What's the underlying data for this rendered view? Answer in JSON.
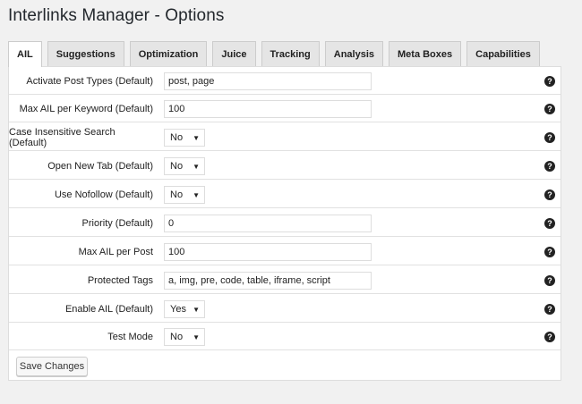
{
  "page": {
    "title": "Interlinks Manager - Options"
  },
  "tabs": [
    {
      "label": "AIL",
      "active": true
    },
    {
      "label": "Suggestions"
    },
    {
      "label": "Optimization"
    },
    {
      "label": "Juice"
    },
    {
      "label": "Tracking"
    },
    {
      "label": "Analysis"
    },
    {
      "label": "Meta Boxes"
    },
    {
      "label": "Capabilities"
    }
  ],
  "options": {
    "activate_post_types": {
      "label": "Activate Post Types (Default)",
      "value": "post, page"
    },
    "max_ail_per_keyword": {
      "label": "Max AIL per Keyword (Default)",
      "value": "100"
    },
    "case_insensitive_search": {
      "label": "Case Insensitive Search (Default)",
      "value": "No"
    },
    "open_new_tab": {
      "label": "Open New Tab (Default)",
      "value": "No"
    },
    "use_nofollow": {
      "label": "Use Nofollow (Default)",
      "value": "No"
    },
    "priority": {
      "label": "Priority (Default)",
      "value": "0"
    },
    "max_ail_per_post": {
      "label": "Max AIL per Post",
      "value": "100"
    },
    "protected_tags": {
      "label": "Protected Tags",
      "value": "a, img, pre, code, table, iframe, script"
    },
    "enable_ail": {
      "label": "Enable AIL (Default)",
      "value": "Yes"
    },
    "test_mode": {
      "label": "Test Mode",
      "value": "No"
    }
  },
  "help_icon": {
    "glyph": "?",
    "icon": "question-circle-icon"
  },
  "select_arrow": "▼",
  "buttons": {
    "save": "Save Changes"
  }
}
